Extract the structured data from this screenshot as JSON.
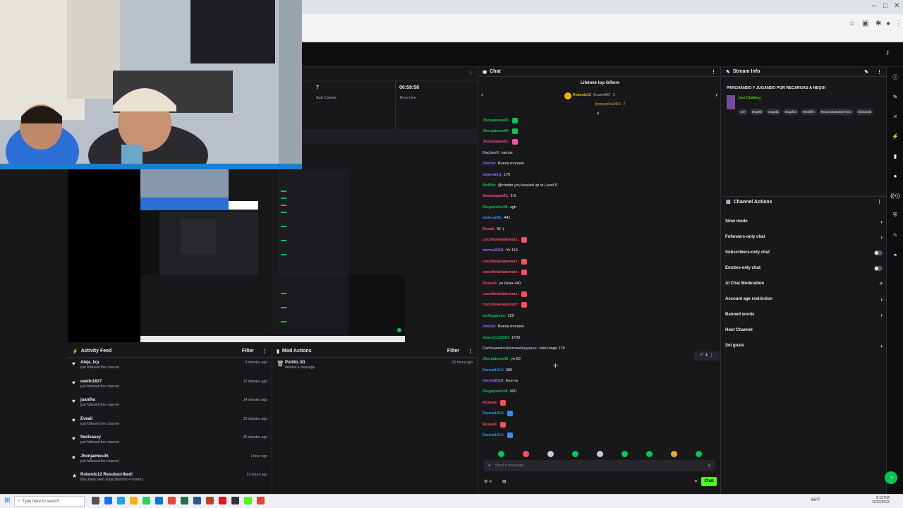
{
  "stats": {
    "sub_count_value": "7",
    "sub_count_label": "Sub Counts",
    "time_live_value": "00:59:58",
    "time_live_label": "Time Live"
  },
  "activity": {
    "title": "Activity Feed",
    "filter": "Filter",
    "items": [
      {
        "name": "Aleja_lxp",
        "desc": "just followed the channel",
        "time": "9 minutes ago"
      },
      {
        "name": "evelin1627",
        "desc": "just followed the channel",
        "time": "12 minutes ago"
      },
      {
        "name": "juan9la",
        "desc": "just followed the channel",
        "time": "14 minutes ago"
      },
      {
        "name": "Eveali",
        "desc": "just followed the channel",
        "time": "33 minutes ago"
      },
      {
        "name": "fleetvasey",
        "desc": "just followed the channel",
        "time": "40 minutes ago"
      },
      {
        "name": "Jhonjaimes45",
        "desc": "just followed the channel",
        "time": "1 hour ago"
      },
      {
        "name": "Rolando12 Resubscribed!",
        "desc": "they have been subscribed for 4 months",
        "time": "23 hours ago"
      }
    ]
  },
  "mod_actions": {
    "title": "Mod Actions",
    "filter": "Filter",
    "items": [
      {
        "name": "Pulido_83",
        "desc": "deleted a message",
        "time": "22 hours ago"
      }
    ]
  },
  "chat": {
    "title": "Chat",
    "gifters_title": "Lifetime top Gifters",
    "gifters": [
      {
        "name": "Rolando12",
        "count": "6"
      },
      {
        "name": "mamell67",
        "count": "3"
      },
      {
        "name": "jhonnysilva2415",
        "count": "2"
      }
    ],
    "messages": [
      {
        "user": "Jhonjaimes45:",
        "text": "",
        "color": "#00c853"
      },
      {
        "user": "Jhonjaimes45:",
        "text": "",
        "color": "#00c853"
      },
      {
        "user": "Jessicapeo61:",
        "text": "",
        "color": "#ff4fa0"
      },
      {
        "user": "Kacheell:",
        "text": "vamos",
        "color": "#adadb8"
      },
      {
        "user": "chetito:",
        "text": "Buena monooo",
        "color": "#9b6cff"
      },
      {
        "user": "valeriahrq:",
        "text": "170",
        "color": "#9b6cff"
      },
      {
        "user": "BotRix:",
        "text": "@chetito you leveled up to Level 5",
        "color": "#00c853"
      },
      {
        "user": "Jessicapeo61:",
        "text": "2.6",
        "color": "#ff4fa0"
      },
      {
        "user": "Dieguitofer28:",
        "text": "sgh",
        "color": "#00c853"
      },
      {
        "user": "walecar81:",
        "text": "441",
        "color": "#2f8fff"
      },
      {
        "user": "Eveali:",
        "text": "35 :(",
        "color": "#ff4fa0"
      },
      {
        "user": "cocofiowidatemutz:",
        "text": "",
        "color": "#ff4f5a"
      },
      {
        "user": "michel2118:",
        "text": "Yo 110",
        "color": "#9b6cff"
      },
      {
        "user": "cocofiowidatemutz:",
        "text": "",
        "color": "#ff4f5a"
      },
      {
        "user": "cocofiowidatemutz:",
        "text": "",
        "color": "#ff4f5a"
      },
      {
        "user": "Roses5:",
        "text": "yo Rosa 440",
        "color": "#ff4f5a"
      },
      {
        "user": "cocofiowidatemutz:",
        "text": "",
        "color": "#ff4f5a"
      },
      {
        "user": "cocofiowidatemutz:",
        "text": "",
        "color": "#ff4f5a"
      },
      {
        "user": "emilygarces:",
        "text": "220",
        "color": "#00c853"
      },
      {
        "user": "chetito:",
        "text": "Buena monooo",
        "color": "#9b6cff"
      },
      {
        "user": "Juanz2122018:",
        "text": "1700",
        "color": "#00c853"
      },
      {
        "user": "Carlosandresbermudezyepes:",
        "text": "solo tengo 170",
        "color": "#adadb8"
      },
      {
        "user": "Jhonjaimes45:",
        "text": "yo 50",
        "color": "#00c853"
      },
      {
        "user": "Danna1314:",
        "text": "380",
        "color": "#2f8fff"
      },
      {
        "user": "michel2118:",
        "text": "Eso no",
        "color": "#9b6cff"
      },
      {
        "user": "Dieguitofer28:",
        "text": "600",
        "color": "#00c853"
      },
      {
        "user": "Roses5:",
        "text": "",
        "color": "#ff4f5a"
      },
      {
        "user": "Danna1314:",
        "text": "",
        "color": "#2f8fff"
      },
      {
        "user": "Roses5:",
        "text": "",
        "color": "#ff4f5a"
      },
      {
        "user": "Danna1314:",
        "text": "",
        "color": "#2f8fff"
      }
    ],
    "input_placeholder": "Send a message",
    "send_label": "Chat"
  },
  "stream_info": {
    "title": "Stream Info",
    "stream_title": "PARCHANDO Y JUGANDO POR RECARGAS A NEQUI",
    "category": "Just Chatting",
    "tags": [
      "18+",
      "English",
      "Bogotá",
      "Español",
      "Medellin",
      "ReaccionandoEnVivo",
      "charlando"
    ]
  },
  "channel_actions": {
    "title": "Channel Actions",
    "rows": [
      {
        "label": "Slow mode",
        "control": "chevron"
      },
      {
        "label": "Followers-only chat",
        "control": "chevron"
      },
      {
        "label": "Subscribers-only chat",
        "control": "toggle"
      },
      {
        "label": "Emotes-only chat",
        "control": "toggle"
      },
      {
        "label": "AI Chat Moderation",
        "control": "external"
      },
      {
        "label": "Account age restriction",
        "control": "chevron"
      },
      {
        "label": "Banned words",
        "control": "chevron"
      },
      {
        "label": "Host Channel",
        "control": "none"
      },
      {
        "label": "Set goals",
        "control": "chevron"
      }
    ]
  },
  "taskbar": {
    "search_placeholder": "Type here to search",
    "weather": "66°F",
    "time": "8:12 PM",
    "date": "11/22/2023"
  }
}
